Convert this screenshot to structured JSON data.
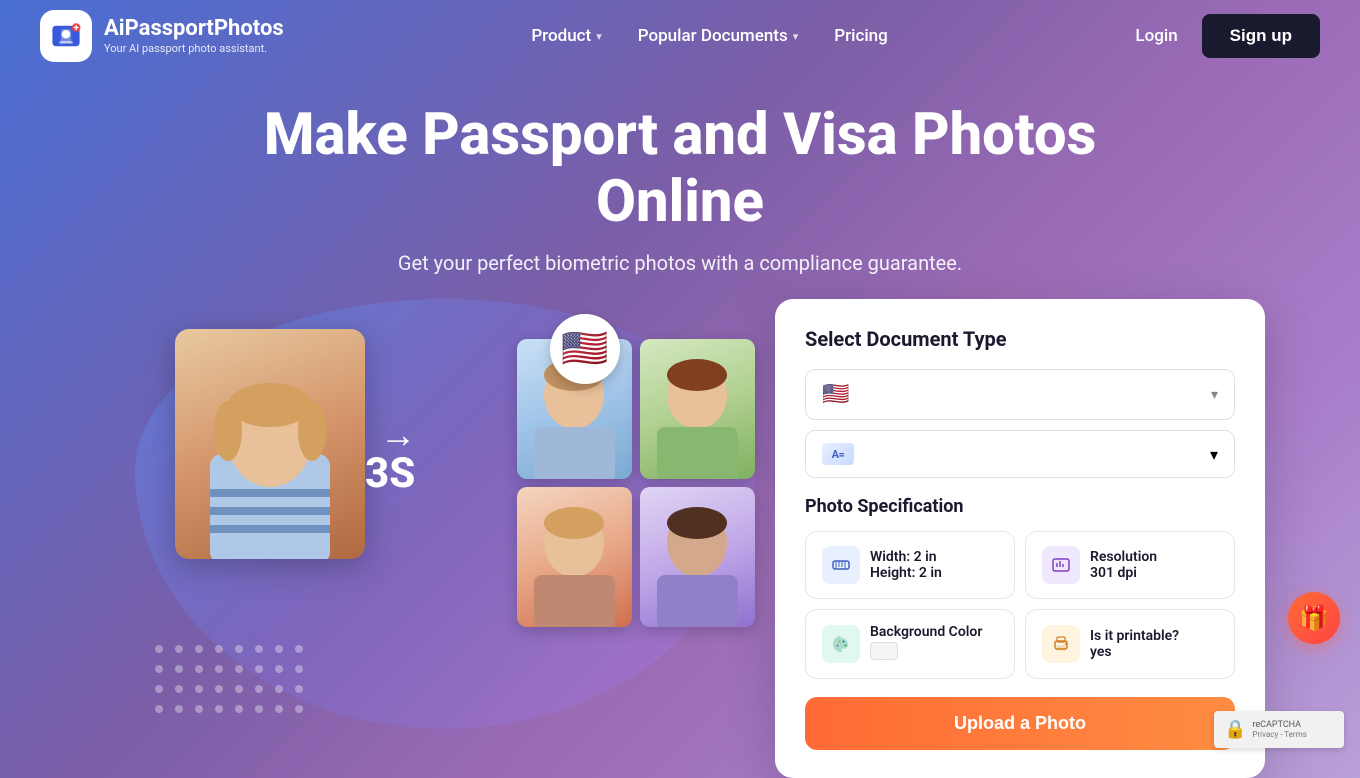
{
  "brand": {
    "logo_text": "AiPassportPhotos",
    "logo_sub": "Your AI passport photo assistant.",
    "logo_bg": "#fff"
  },
  "nav": {
    "product_label": "Product",
    "popular_docs_label": "Popular Documents",
    "pricing_label": "Pricing",
    "login_label": "Login",
    "signup_label": "Sign up"
  },
  "hero": {
    "title": "Make Passport and Visa Photos Online",
    "subtitle": "Get your perfect biometric photos with a compliance guarantee."
  },
  "illustration": {
    "arrow": "→",
    "speed_badge": "3S",
    "flag_emoji": "🇺🇸"
  },
  "form": {
    "select_document_title": "Select Document Type",
    "country_placeholder": "🇺🇸",
    "doc_placeholder": "A=",
    "photo_spec_title": "Photo Specification",
    "specs": [
      {
        "icon": "ruler-icon",
        "icon_bg": "blue",
        "label": "Width: 2 in\nHeight: 2 in"
      },
      {
        "icon": "resolution-icon",
        "icon_bg": "purple",
        "label": "Resolution\n301 dpi"
      },
      {
        "icon": "color-icon",
        "icon_bg": "teal",
        "label": "Background Color",
        "has_swatch": true
      },
      {
        "icon": "print-icon",
        "icon_bg": "orange",
        "label": "Is it printable?\nyes"
      }
    ],
    "upload_button_label": "Upload a Photo"
  },
  "recaptcha": {
    "line1": "reCAPTCHA",
    "line2": "Privacy - Terms"
  }
}
